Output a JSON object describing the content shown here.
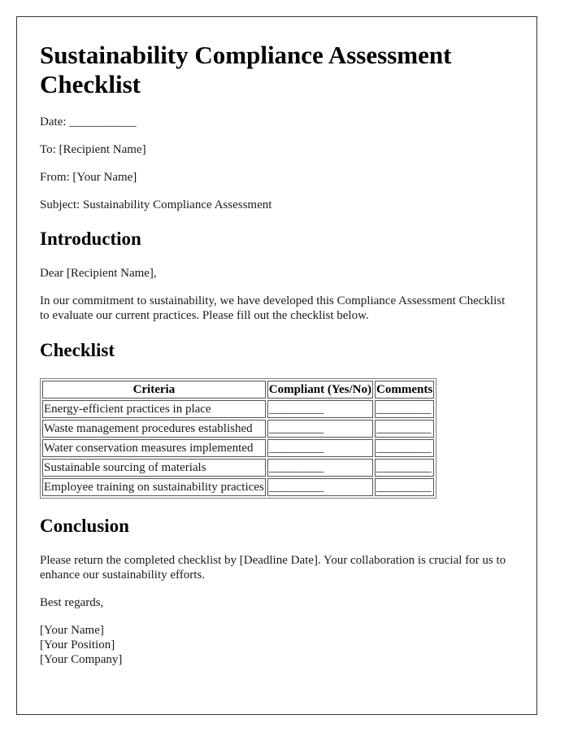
{
  "title": "Sustainability Compliance Assessment Checklist",
  "meta": {
    "date_label": "Date:",
    "date_value": "___________",
    "to": "To: [Recipient Name]",
    "from": "From: [Your Name]",
    "subject": "Subject: Sustainability Compliance Assessment"
  },
  "introduction": {
    "heading": "Introduction",
    "greeting": "Dear [Recipient Name],",
    "body": "In our commitment to sustainability, we have developed this Compliance Assessment Checklist to evaluate our current practices. Please fill out the checklist below."
  },
  "checklist": {
    "heading": "Checklist",
    "columns": [
      "Criteria",
      "Compliant (Yes/No)",
      "Comments"
    ],
    "rows": [
      {
        "criteria": "Energy-efficient practices in place",
        "compliant": "_________",
        "comments": "_________"
      },
      {
        "criteria": "Waste management procedures established",
        "compliant": "_________",
        "comments": "_________"
      },
      {
        "criteria": "Water conservation measures implemented",
        "compliant": "_________",
        "comments": "_________"
      },
      {
        "criteria": "Sustainable sourcing of materials",
        "compliant": "_________",
        "comments": "_________"
      },
      {
        "criteria": "Employee training on sustainability practices",
        "compliant": "_________",
        "comments": "_________"
      }
    ]
  },
  "conclusion": {
    "heading": "Conclusion",
    "body": "Please return the completed checklist by [Deadline Date]. Your collaboration is crucial for us to enhance our sustainability efforts.",
    "closing": "Best regards,",
    "signature": [
      "[Your Name]",
      "[Your Position]",
      "[Your Company]"
    ]
  }
}
